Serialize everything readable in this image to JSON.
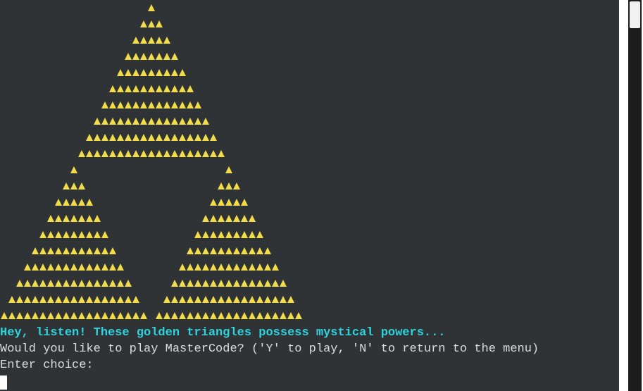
{
  "terminal": {
    "art": {
      "glyph": "▲",
      "color": "#f2dc4a",
      "rows_per_triangle": 10,
      "triangles": [
        "top",
        "bottom-left",
        "bottom-right"
      ]
    },
    "lines": {
      "hint": "Hey, listen! These golden triangles possess mystical powers...",
      "prompt": "Would you like to play MasterCode? ('Y' to play, 'N' to return to the menu)",
      "input_label": "Enter choice:"
    },
    "colors": {
      "background": "#2f3336",
      "hint": "#2ed3dc",
      "text": "#dcdcdc"
    }
  },
  "scrollbar": {
    "thumb_position": 0
  }
}
